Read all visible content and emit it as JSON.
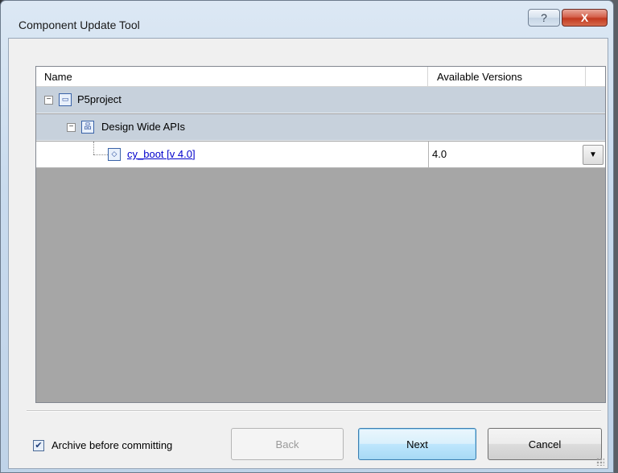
{
  "window": {
    "title": "Component Update Tool",
    "help_label": "?",
    "close_label": "X"
  },
  "list": {
    "columns": [
      "Name",
      "Available Versions"
    ],
    "rows": [
      {
        "label": "P5project",
        "expander": "−",
        "icon": "project-icon"
      },
      {
        "label": "Design Wide APIs",
        "expander": "−",
        "icon": "schematic-icon"
      },
      {
        "label": "cy_boot [v 4.0]",
        "icon": "component-icon",
        "version": "4.0"
      }
    ],
    "dropdown_arrow": "▼"
  },
  "footer": {
    "archive_label": "Archive before committing",
    "archive_checked": true,
    "back_label": "Back",
    "next_label": "Next",
    "cancel_label": "Cancel"
  }
}
